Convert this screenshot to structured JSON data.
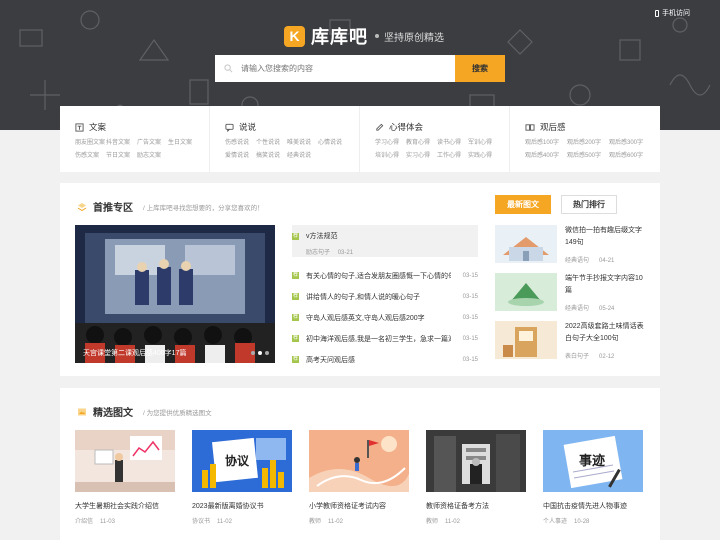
{
  "header": {
    "mobile_link": "手机访问",
    "logo_letter": "K",
    "brand_name": "库库吧",
    "slogan": "坚持原创精选",
    "search_placeholder": "请输入您搜索的内容",
    "search_button": "搜索",
    "accent_color": "#f5a623"
  },
  "categories": [
    {
      "icon": "text-doc-icon",
      "title": "文案",
      "links": [
        "朋友圈文案",
        "抖音文案",
        "广告文案",
        "生日文案",
        "伤感文案",
        "节日文案",
        "励志文案"
      ]
    },
    {
      "icon": "chat-bubble-icon",
      "title": "说说",
      "links": [
        "伤感说说",
        "个性说说",
        "唯美说说",
        "心情说说",
        "爱情说说",
        "搞笑说说",
        "经典说说"
      ]
    },
    {
      "icon": "pencil-icon",
      "title": "心得体会",
      "links": [
        "学习心得",
        "教育心得",
        "读书心得",
        "军训心得",
        "培训心得",
        "实习心得",
        "工作心得",
        "实践心得"
      ]
    },
    {
      "icon": "book-icon",
      "title": "观后感",
      "links": [
        "观后感100字",
        "观后感200字",
        "观后感300字",
        "观后感400字",
        "观后感500字",
        "观后感600字"
      ]
    }
  ],
  "recommend": {
    "title": "首推专区",
    "subtitle": "/ 上库库吧寻找您想要的，分享您喜欢的！",
    "featured_caption": "天宫课堂第二课观后感400字17篇",
    "top_article": {
      "title": "v方法规范",
      "category": "励志句子",
      "date": "03-21"
    },
    "articles": [
      {
        "title": "有关心情的句子,适合发朋友圈感慨一下心情的句子",
        "date": "03-15"
      },
      {
        "title": "讲给情人的句子,和情人说的暖心句子",
        "date": "03-15"
      },
      {
        "title": "守岛人观后感英文,守岛人观后感200字",
        "date": "03-15"
      },
      {
        "title": "初中海洋观后感,我是一名初三学生，急求一篇海洋的观后感",
        "date": "03-15"
      },
      {
        "title": "高考天问观后感",
        "date": "03-15"
      }
    ],
    "tabs": [
      "最新图文",
      "热门排行"
    ],
    "side_items": [
      {
        "title": "微信拍一拍有趣后缀文字149句",
        "category": "经典语句",
        "date": "04-21"
      },
      {
        "title": "端午节手抄报文字内容10篇",
        "category": "经典语句",
        "date": "05-24"
      },
      {
        "title": "2022高级套路土味情话表白句子大全100句",
        "category": "表白句子",
        "date": "02-12"
      }
    ]
  },
  "picks": {
    "title": "精选图文",
    "subtitle": "/ 为您提供优质精选图文",
    "cards": [
      {
        "title": "大学生暑期社会实践介绍信",
        "category": "介绍信",
        "date": "11-03"
      },
      {
        "title": "2023最新版离婚协议书",
        "category": "协议书",
        "date": "11-02"
      },
      {
        "title": "小学教师资格证考试内容",
        "category": "教师",
        "date": "11-02"
      },
      {
        "title": "教师资格证备考方法",
        "category": "教师",
        "date": "11-02"
      },
      {
        "title": "中国抗击疫情先进人物事迹",
        "category": "个人事迹",
        "date": "10-28"
      }
    ],
    "card_img_text": [
      "协议",
      "事迹"
    ]
  }
}
